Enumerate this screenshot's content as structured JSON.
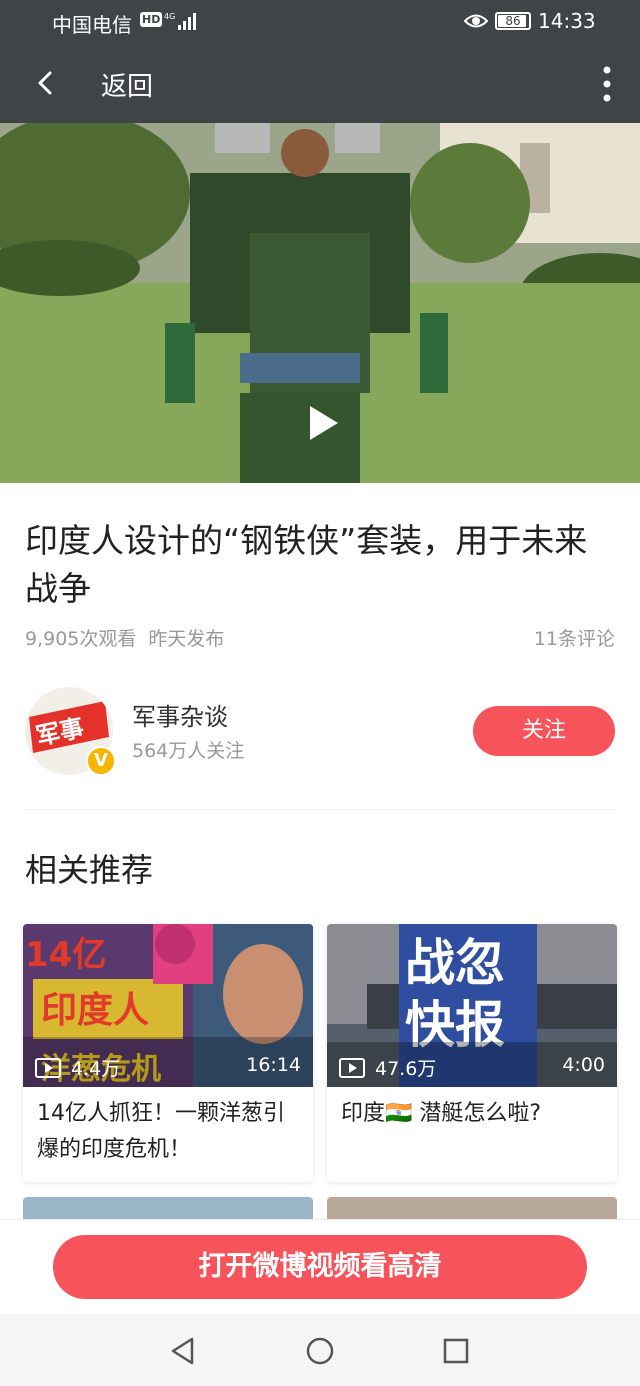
{
  "status_bar": {
    "carrier": "中国电信",
    "hd_badge": "HD",
    "battery": "86",
    "time": "14:33"
  },
  "nav": {
    "back_label": "返回"
  },
  "video": {
    "title": "印度人设计的“钢铁侠”套装，用于未来战争",
    "views": "9,905次观看",
    "published": "昨天发布",
    "comments": "11条评论"
  },
  "author": {
    "name": "军事杂谈",
    "followers": "564万人关注",
    "avatar_text": "军事",
    "follow_label": "关注"
  },
  "related": {
    "heading": "相关推荐",
    "items": [
      {
        "title": "14亿人抓狂！一颗洋葱引爆的印度危机！",
        "views": "4.4万",
        "duration": "16:14"
      },
      {
        "title": "印度🇮🇳 潜艇怎么啦?",
        "views": "47.6万",
        "duration": "4:00"
      }
    ]
  },
  "cta": {
    "label": "打开微博视频看高清"
  },
  "colors": {
    "accent": "#f6535a",
    "header_bg": "#3f4546"
  }
}
